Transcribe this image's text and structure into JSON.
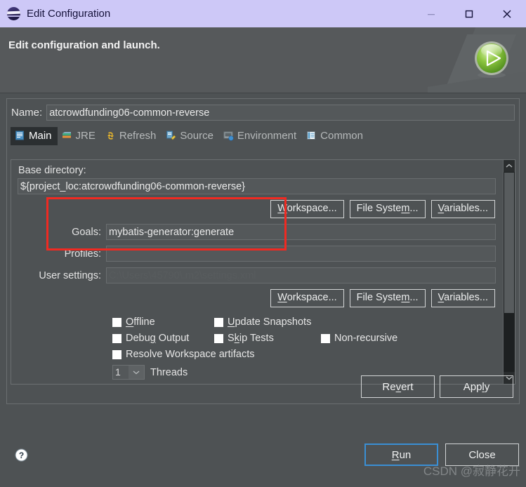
{
  "window": {
    "title": "Edit Configuration",
    "app_icon": "eclipse-icon",
    "minimize_label": "—",
    "maximize_label": "☐",
    "close_label": "✕"
  },
  "header": {
    "title": "Edit configuration and launch.",
    "icon": "run-play-sphere-icon"
  },
  "name": {
    "label": "Name:",
    "value": "atcrowdfunding06-common-reverse"
  },
  "tabs": [
    {
      "label": "Main",
      "icon": "main-document-icon",
      "active": true
    },
    {
      "label": "JRE",
      "icon": "jre-library-icon",
      "active": false
    },
    {
      "label": "Refresh",
      "icon": "refresh-arrows-icon",
      "active": false
    },
    {
      "label": "Source",
      "icon": "source-edit-icon",
      "active": false
    },
    {
      "label": "Environment",
      "icon": "environment-icon",
      "active": false
    },
    {
      "label": "Common",
      "icon": "common-document-icon",
      "active": false
    }
  ],
  "form": {
    "base_directory_label": "Base directory:",
    "base_directory_value": "${project_loc:atcrowdfunding06-common-reverse}",
    "goals_label": "Goals:",
    "goals_value": "mybatis-generator:generate",
    "profiles_label": "Profiles:",
    "profiles_value": "",
    "user_settings_label": "User settings:",
    "user_settings_value": "C:\\Users\\45790\\.m2\\settings.xml",
    "browse_buttons_top": [
      {
        "label": "Workspace...",
        "mnemonic": "W"
      },
      {
        "label": "File System...",
        "mnemonic": "m"
      },
      {
        "label": "Variables...",
        "mnemonic": "V"
      }
    ],
    "browse_buttons_bottom": [
      {
        "label": "Workspace...",
        "mnemonic": "W"
      },
      {
        "label": "File System...",
        "mnemonic": "m"
      },
      {
        "label": "Variables...",
        "mnemonic": "V"
      }
    ],
    "checkboxes": [
      {
        "label": "Offline",
        "checked": false
      },
      {
        "label": "Update Snapshots",
        "checked": false
      },
      {
        "label": "Debug Output",
        "checked": false
      },
      {
        "label": "Skip Tests",
        "checked": false
      },
      {
        "label": "Non-recursive",
        "checked": false
      },
      {
        "label": "Resolve Workspace artifacts",
        "checked": false
      }
    ],
    "threads": {
      "value": "1",
      "label": "Threads"
    }
  },
  "actions": {
    "revert_label": "Revert",
    "apply_label": "Apply",
    "run_label": "Run",
    "close_label": "Close",
    "help_icon": "help-question-icon"
  },
  "annotation": {
    "color": "#f02a22",
    "target": "goals-field-highlight"
  },
  "watermark": {
    "text": "CSDN @寂静花开"
  }
}
